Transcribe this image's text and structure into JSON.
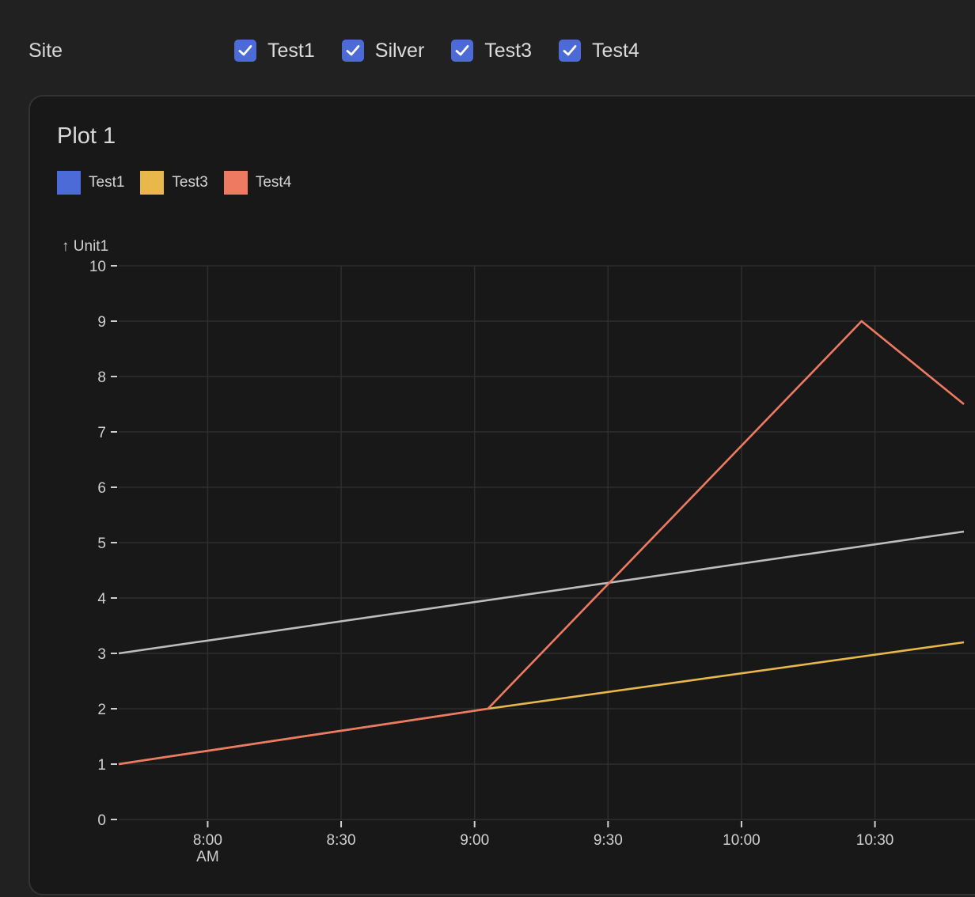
{
  "filter": {
    "label": "Site",
    "options": [
      {
        "label": "Test1",
        "checked": true
      },
      {
        "label": "Silver",
        "checked": true
      },
      {
        "label": "Test3",
        "checked": true
      },
      {
        "label": "Test4",
        "checked": true
      }
    ],
    "checkbox_color": "#4d6bd6"
  },
  "panel": {
    "title": "Plot 1"
  },
  "chart_data": {
    "type": "line",
    "title": "Plot 1",
    "ylabel": "↑ Unit1",
    "xlabel": "",
    "ylim": [
      0,
      10
    ],
    "xlim": [
      "7:40",
      "10:50"
    ],
    "x_unit": "time of day (AM)",
    "x_ticks": [
      {
        "value": "8:00",
        "label": "8:00",
        "sublabel": "AM"
      },
      {
        "value": "8:30",
        "label": "8:30"
      },
      {
        "value": "9:00",
        "label": "9:00"
      },
      {
        "value": "9:30",
        "label": "9:30"
      },
      {
        "value": "10:00",
        "label": "10:00"
      },
      {
        "value": "10:30",
        "label": "10:30"
      }
    ],
    "y_ticks": [
      0,
      1,
      2,
      3,
      4,
      5,
      6,
      7,
      8,
      9,
      10
    ],
    "grid": true,
    "legend": [
      {
        "name": "Test1",
        "color": "#4d6bd6"
      },
      {
        "name": "Test3",
        "color": "#e8b84a"
      },
      {
        "name": "Test4",
        "color": "#ee7a62"
      }
    ],
    "series": [
      {
        "color": "#bdbdbd",
        "x": [
          "7:40",
          "10:50"
        ],
        "y": [
          3,
          5.2
        ]
      },
      {
        "color": "#e8b84a",
        "x": [
          "7:40",
          "9:03",
          "10:50"
        ],
        "y": [
          1,
          2,
          3.2
        ]
      },
      {
        "color": "#ee7a62",
        "x": [
          "7:40",
          "9:03",
          "10:27",
          "10:50"
        ],
        "y": [
          1,
          2,
          9,
          7.5
        ]
      }
    ]
  }
}
